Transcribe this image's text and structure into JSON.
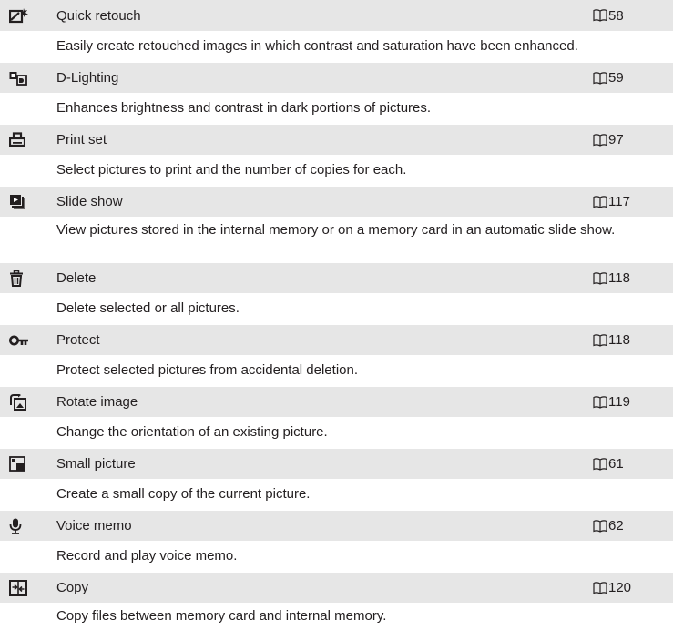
{
  "rows": [
    {
      "name": "Quick retouch",
      "ref": "58",
      "desc": "Easily create retouched images in which contrast and saturation have been enhanced.",
      "icon": "quick-retouch-icon"
    },
    {
      "name": "D-Lighting",
      "ref": "59",
      "desc": "Enhances brightness and contrast in dark portions of pictures.",
      "icon": "d-lighting-icon"
    },
    {
      "name": "Print set",
      "ref": "97",
      "desc": "Select pictures to print and the number of copies for each.",
      "icon": "print-set-icon"
    },
    {
      "name": "Slide show",
      "ref": "117",
      "desc": "View pictures stored in the internal memory or on a memory card in an automatic slide show.",
      "icon": "slide-show-icon"
    },
    {
      "name": "Delete",
      "ref": "118",
      "desc": "Delete selected or all pictures.",
      "icon": "delete-icon"
    },
    {
      "name": "Protect",
      "ref": "118",
      "desc": "Protect selected pictures from accidental deletion.",
      "icon": "protect-icon"
    },
    {
      "name": "Rotate image",
      "ref": "119",
      "desc": "Change the orientation of an existing picture.",
      "icon": "rotate-image-icon"
    },
    {
      "name": "Small picture",
      "ref": "61",
      "desc": "Create a small copy of the current picture.",
      "icon": "small-picture-icon"
    },
    {
      "name": "Voice memo",
      "ref": "62",
      "desc": "Record and play voice memo.",
      "icon": "voice-memo-icon"
    },
    {
      "name": "Copy",
      "ref": "120",
      "desc": "Copy files between memory card and internal memory.",
      "icon": "copy-icon"
    }
  ],
  "ref_symbol_icon": "book-reference-icon"
}
